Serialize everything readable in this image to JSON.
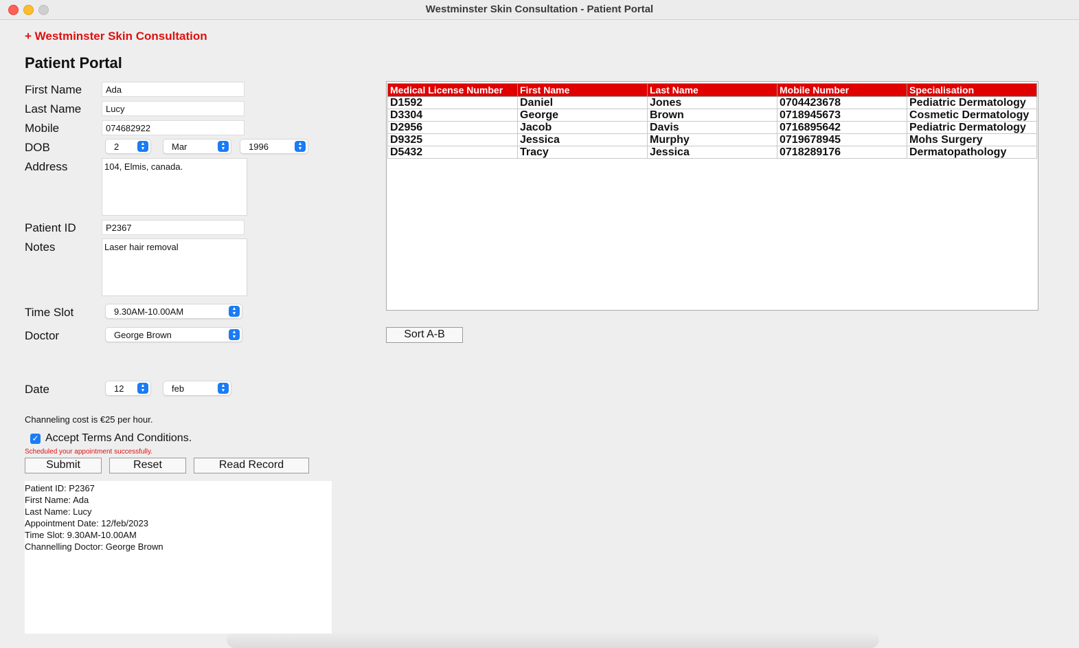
{
  "window": {
    "title": "Westminster Skin Consultation - Patient Portal"
  },
  "brand": "+ Westminster Skin Consultation",
  "heading": "Patient Portal",
  "form": {
    "first_name_label": "First Name",
    "first_name_value": "Ada",
    "last_name_label": "Last Name",
    "last_name_value": "Lucy",
    "mobile_label": "Mobile",
    "mobile_value": "074682922",
    "dob_label": "DOB",
    "dob_day": "2",
    "dob_month": "Mar",
    "dob_year": "1996",
    "address_label": "Address",
    "address_value": "104, Elmis, canada.",
    "patient_id_label": "Patient ID",
    "patient_id_value": "P2367",
    "notes_label": "Notes",
    "notes_value": "Laser hair removal",
    "time_slot_label": "Time Slot",
    "time_slot_value": "9.30AM-10.00AM",
    "doctor_label": "Doctor",
    "doctor_value": "George Brown",
    "date_label": "Date",
    "date_day": "12",
    "date_month": "feb",
    "cost_text": "Channeling cost is €25 per hour.",
    "terms_label": "Accept Terms And Conditions.",
    "terms_checked": true,
    "status_message": "Scheduled your appointment successfully.",
    "status_color": "#e01010"
  },
  "buttons": {
    "submit": "Submit",
    "reset": "Reset",
    "read_record": "Read Record",
    "sort": "Sort A-B"
  },
  "table": {
    "header_color": "#e00000",
    "columns": [
      "Medical License Number",
      "First Name",
      "Last Name",
      "Mobile Number",
      "Specialisation"
    ],
    "rows": [
      [
        "D1592",
        "Daniel",
        "Jones",
        "0704423678",
        "Pediatric Dermatology"
      ],
      [
        "D3304",
        "George",
        "Brown",
        "0718945673",
        "Cosmetic Dermatology"
      ],
      [
        "D2956",
        "Jacob",
        "Davis",
        "0716895642",
        "Pediatric Dermatology"
      ],
      [
        "D9325",
        "Jessica",
        "Murphy",
        "0719678945",
        "Mohs Surgery"
      ],
      [
        "D5432",
        "Tracy",
        "Jessica",
        "0718289176",
        "Dermatopathology"
      ]
    ]
  },
  "record_output": [
    "Patient ID: P2367",
    "First Name: Ada",
    "Last Name: Lucy",
    "Appointment Date: 12/feb/2023",
    "Time Slot: 9.30AM-10.00AM",
    "Channelling Doctor: George Brown"
  ]
}
